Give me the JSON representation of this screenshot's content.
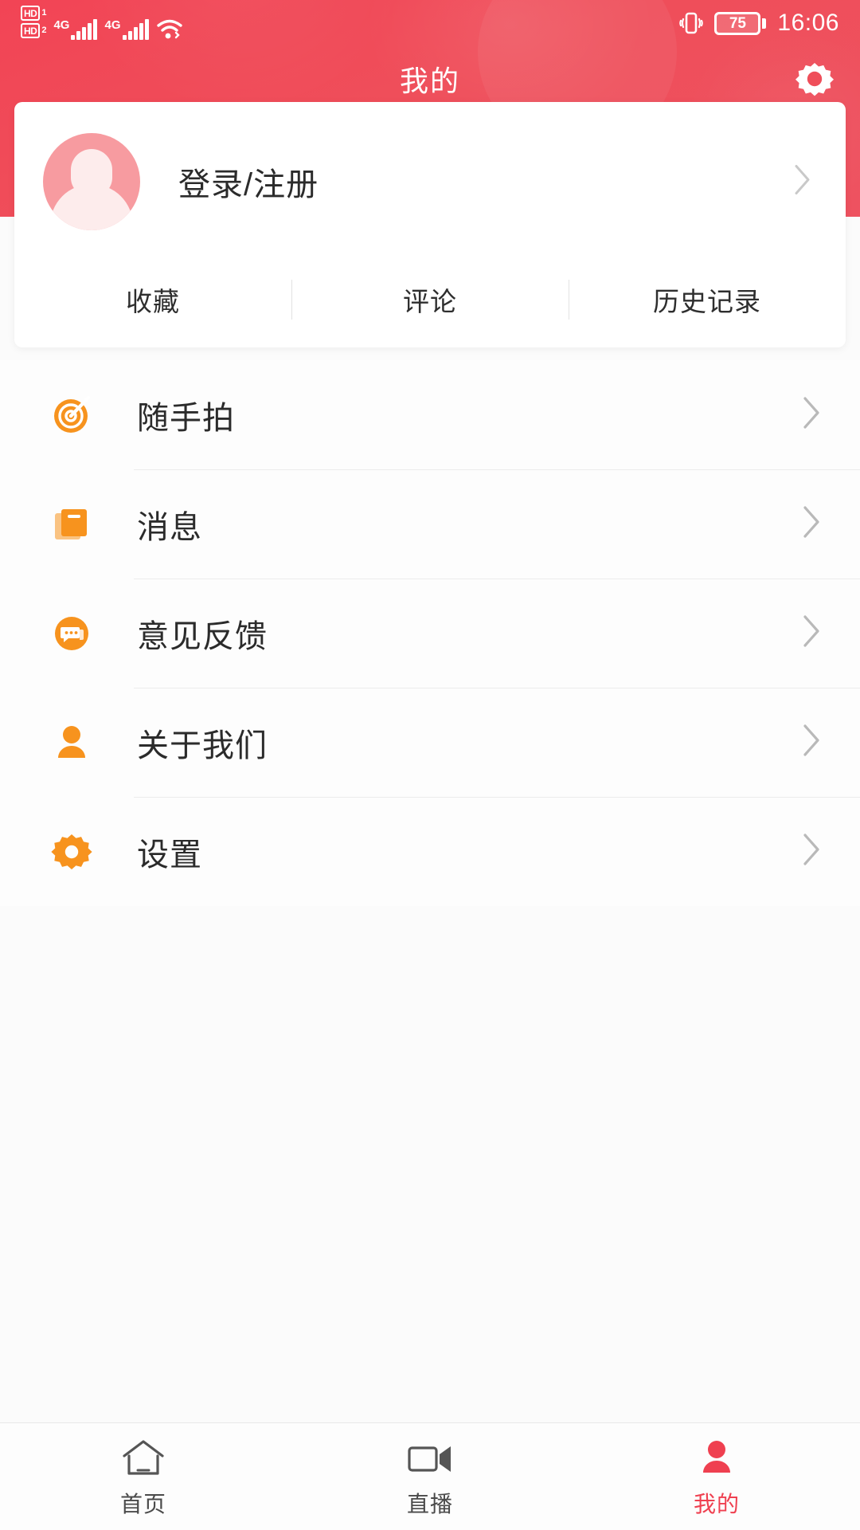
{
  "theme": {
    "brand_red": "#ef4050",
    "icon_orange": "#f7931e",
    "avatar_pink": "#f79ba0",
    "text_dark": "#2b2b2b"
  },
  "statusbar": {
    "hd1_label": "HD",
    "hd1_sim": "1",
    "hd2_label": "HD",
    "hd2_sim": "2",
    "network1": "4G",
    "network2": "4G",
    "wifi_icon": "wifi-icon",
    "vibrate_icon": "vibrate-icon",
    "battery_percent": "75",
    "time": "16:06"
  },
  "header": {
    "title": "我的",
    "settings_icon": "gear-icon"
  },
  "profile": {
    "avatar_icon": "avatar-placeholder-icon",
    "login_label": "登录/注册",
    "chevron_icon": "chevron-right-icon"
  },
  "tabs": [
    {
      "label": "收藏",
      "name": "tab-favorites"
    },
    {
      "label": "评论",
      "name": "tab-comments"
    },
    {
      "label": "历史记录",
      "name": "tab-history"
    }
  ],
  "menu": [
    {
      "label": "随手拍",
      "icon": "target-camera-icon"
    },
    {
      "label": "消息",
      "icon": "book-message-icon"
    },
    {
      "label": "意见反馈",
      "icon": "chat-bubble-icon"
    },
    {
      "label": "关于我们",
      "icon": "person-icon"
    },
    {
      "label": "设置",
      "icon": "gear-icon"
    }
  ],
  "bottomnav": [
    {
      "label": "首页",
      "icon": "home-icon",
      "active": false
    },
    {
      "label": "直播",
      "icon": "video-camera-icon",
      "active": false
    },
    {
      "label": "我的",
      "icon": "person-filled-icon",
      "active": true
    }
  ]
}
